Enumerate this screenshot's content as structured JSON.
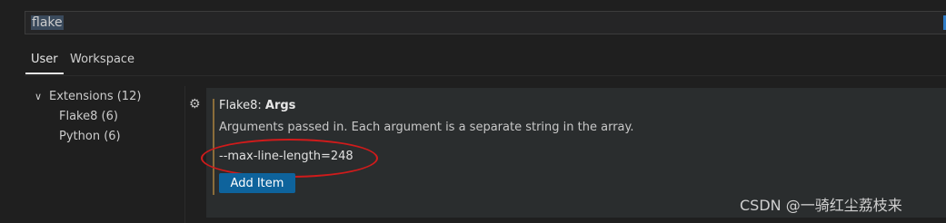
{
  "search": {
    "value_highlighted": "flake"
  },
  "tabs": [
    {
      "label": "User",
      "active": true
    },
    {
      "label": "Workspace",
      "active": false
    }
  ],
  "tree": {
    "extensions_label": "Extensions (12)",
    "items": [
      {
        "label": "Flake8 (6)"
      },
      {
        "label": "Python (6)"
      }
    ]
  },
  "setting": {
    "category": "Flake8: ",
    "name": "Args",
    "description": "Arguments passed in. Each argument is a separate string in the array.",
    "items": [
      "--max-line-length=248"
    ],
    "add_button_label": "Add Item"
  },
  "watermark": "CSDN @一骑红尘荔枝来",
  "colors": {
    "background": "#1f1f1f",
    "panel": "#2a2d2e",
    "accent_blue": "#0e639c",
    "annotation_red": "#d01b1b",
    "modified_bar": "#8a6d3a"
  }
}
